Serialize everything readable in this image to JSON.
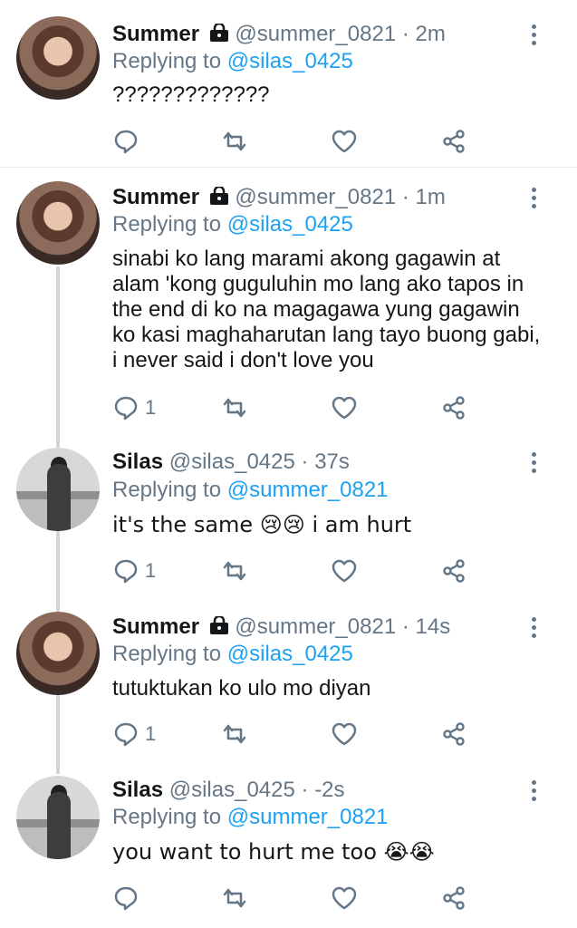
{
  "tweets": [
    {
      "name": "Summer",
      "handle": "@summer_0821",
      "dot": "·",
      "time": "2m",
      "reply_prefix": "Replying to",
      "reply_to": "@silas_0425",
      "text": "?????????????",
      "replies": "",
      "avatar": "summer",
      "locked": true
    },
    {
      "name": "Summer",
      "handle": "@summer_0821",
      "dot": "·",
      "time": "1m",
      "reply_prefix": "Replying to",
      "reply_to": "@silas_0425",
      "text": "sinabi ko lang marami akong gagawin at alam 'kong guguluhin mo lang ako tapos in the end di ko na magagawa yung gagawin ko kasi maghaharutan lang tayo buong gabi, i never said i don't love you",
      "replies": "1",
      "avatar": "summer",
      "locked": true
    },
    {
      "name": "Silas",
      "handle": "@silas_0425",
      "dot": "·",
      "time": "37s",
      "reply_prefix": "Replying to",
      "reply_to": "@summer_0821",
      "text": "it's the same 😢😢 i am hurt",
      "replies": "1",
      "avatar": "silas",
      "locked": false
    },
    {
      "name": "Summer",
      "handle": "@summer_0821",
      "dot": "·",
      "time": "14s",
      "reply_prefix": "Replying to",
      "reply_to": "@silas_0425",
      "text": "tutuktukan ko ulo mo diyan",
      "replies": "1",
      "avatar": "summer",
      "locked": true
    },
    {
      "name": "Silas",
      "handle": "@silas_0425",
      "dot": "·",
      "time": "-2s",
      "reply_prefix": "Replying to",
      "reply_to": "@summer_0821",
      "text": "you want to hurt me too 😭😭",
      "replies": "",
      "avatar": "silas",
      "locked": false
    }
  ],
  "colors": {
    "link": "#1da1f2",
    "muted": "#657786",
    "text": "#14171a",
    "thread": "#ccd6dd"
  },
  "icons": {
    "reply": "reply-icon",
    "retweet": "retweet-icon",
    "like": "heart-icon",
    "share": "share-icon",
    "more": "more-vertical-icon",
    "lock": "lock-icon"
  }
}
